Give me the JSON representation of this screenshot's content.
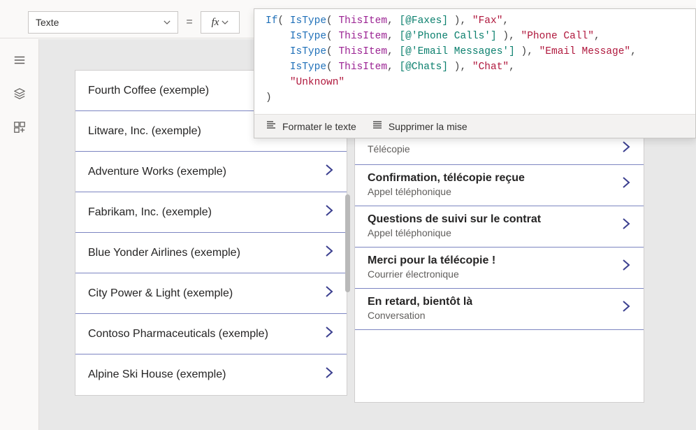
{
  "topbar": {
    "property_label": "Texte",
    "equals": "=",
    "fx_label": "fx"
  },
  "formula": {
    "tokens": [
      [
        {
          "t": "If",
          "c": "fn"
        },
        {
          "t": "( ",
          "c": "pn"
        },
        {
          "t": "IsType",
          "c": "fn"
        },
        {
          "t": "( ",
          "c": "pn"
        },
        {
          "t": "ThisItem",
          "c": "id"
        },
        {
          "t": ", ",
          "c": "pn"
        },
        {
          "t": "[@Faxes]",
          "c": "ds"
        },
        {
          "t": " ), ",
          "c": "pn"
        },
        {
          "t": "\"Fax\"",
          "c": "str"
        },
        {
          "t": ",",
          "c": "pn"
        }
      ],
      [
        {
          "t": "    ",
          "c": "pn"
        },
        {
          "t": "IsType",
          "c": "fn"
        },
        {
          "t": "( ",
          "c": "pn"
        },
        {
          "t": "ThisItem",
          "c": "id"
        },
        {
          "t": ", ",
          "c": "pn"
        },
        {
          "t": "[@'Phone Calls']",
          "c": "ds"
        },
        {
          "t": " ), ",
          "c": "pn"
        },
        {
          "t": "\"Phone Call\"",
          "c": "str"
        },
        {
          "t": ",",
          "c": "pn"
        }
      ],
      [
        {
          "t": "    ",
          "c": "pn"
        },
        {
          "t": "IsType",
          "c": "fn"
        },
        {
          "t": "( ",
          "c": "pn"
        },
        {
          "t": "ThisItem",
          "c": "id"
        },
        {
          "t": ", ",
          "c": "pn"
        },
        {
          "t": "[@'Email Messages']",
          "c": "ds"
        },
        {
          "t": " ), ",
          "c": "pn"
        },
        {
          "t": "\"Email Message\"",
          "c": "str"
        },
        {
          "t": ",",
          "c": "pn"
        }
      ],
      [
        {
          "t": "    ",
          "c": "pn"
        },
        {
          "t": "IsType",
          "c": "fn"
        },
        {
          "t": "( ",
          "c": "pn"
        },
        {
          "t": "ThisItem",
          "c": "id"
        },
        {
          "t": ", ",
          "c": "pn"
        },
        {
          "t": "[@Chats]",
          "c": "ds"
        },
        {
          "t": " ), ",
          "c": "pn"
        },
        {
          "t": "\"Chat\"",
          "c": "str"
        },
        {
          "t": ",",
          "c": "pn"
        }
      ],
      [
        {
          "t": "    ",
          "c": "pn"
        },
        {
          "t": "\"Unknown\"",
          "c": "str"
        }
      ],
      [
        {
          "t": ")",
          "c": "pn"
        }
      ]
    ],
    "toolbar": {
      "format_text": "Formater le texte",
      "remove_format": "Supprimer la mise"
    }
  },
  "leftrail": {
    "icons": [
      "hamburger-icon",
      "layers-icon",
      "insert-icon"
    ]
  },
  "list_left": {
    "items": [
      "Fourth Coffee (exemple)",
      "Litware, Inc. (exemple)",
      "Adventure Works (exemple)",
      "Fabrikam, Inc. (exemple)",
      "Blue Yonder Airlines (exemple)",
      "City Power & Light (exemple)",
      "Contoso Pharmaceuticals (exemple)",
      "Alpine Ski House (exemple)"
    ]
  },
  "list_right": {
    "items": [
      {
        "title": "",
        "subtitle": "Télécopie",
        "partial": true
      },
      {
        "title": "Confirmation, télécopie reçue",
        "subtitle": "Appel téléphonique"
      },
      {
        "title": "Questions de suivi sur le contrat",
        "subtitle": "Appel téléphonique"
      },
      {
        "title": "Merci pour la télécopie !",
        "subtitle": "Courrier électronique"
      },
      {
        "title": "En retard, bientôt là",
        "subtitle": "Conversation"
      }
    ]
  }
}
